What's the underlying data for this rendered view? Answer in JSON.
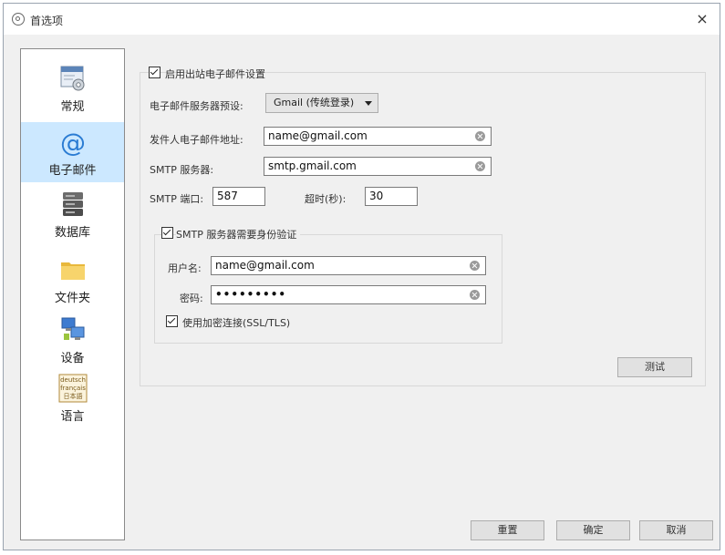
{
  "window": {
    "title": "首选项",
    "close_glyph": "×"
  },
  "sidebar": {
    "items": [
      {
        "label": "常规",
        "icon": "settings-icon"
      },
      {
        "label": "电子邮件",
        "icon": "at-sign-icon",
        "selected": true
      },
      {
        "label": "数据库",
        "icon": "database-icon"
      },
      {
        "label": "文件夹",
        "icon": "folder-icon"
      },
      {
        "label": "设备",
        "icon": "devices-icon"
      },
      {
        "label": "语言",
        "icon": "language-icon",
        "icon_text": [
          "deutsch",
          "français",
          "日本語"
        ]
      }
    ]
  },
  "email": {
    "enable_label": "启用出站电子邮件设置",
    "enable_checked": true,
    "preset_label": "电子邮件服务器预设:",
    "preset_value": "Gmail (传统登录)",
    "sender_label": "发件人电子邮件地址:",
    "sender_value": "name@gmail.com",
    "smtp_label": "SMTP 服务器:",
    "smtp_value": "smtp.gmail.com",
    "port_label": "SMTP 端口:",
    "port_value": "587",
    "timeout_label": "超时(秒):",
    "timeout_value": "30",
    "auth": {
      "label": "SMTP 服务器需要身份验证",
      "checked": true,
      "username_label": "用户名:",
      "username_value": "name@gmail.com",
      "password_label": "密码:",
      "password_value": "•••••••••",
      "ssl_label": "使用加密连接(SSL/TLS)",
      "ssl_checked": true
    },
    "test_button": "测试"
  },
  "footer": {
    "reset_button": "重置",
    "ok_button": "确定",
    "cancel_button": "取消"
  },
  "colors": {
    "selected_bg": "#cce8ff",
    "at_blue": "#2b7cd3"
  }
}
